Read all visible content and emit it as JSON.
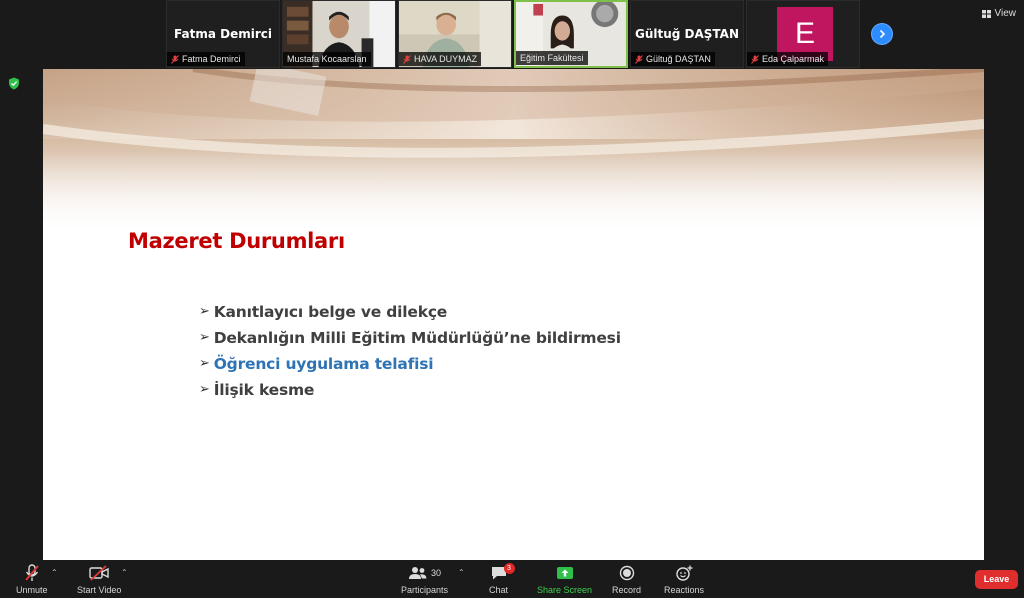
{
  "participants_strip": [
    {
      "name": "Fatma Demirci",
      "caption": "Fatma Demirci",
      "muted": true,
      "video": false
    },
    {
      "name": "Mustafa Kocaarslan",
      "caption": "Mustafa Kocaarslan",
      "muted": false,
      "video": true
    },
    {
      "name": "HAVA DUYMAZ",
      "caption": "HAVA DUYMAZ",
      "muted": true,
      "video": true
    },
    {
      "name": "Eğitim Fakültesi",
      "caption": "Eğitim Fakültesi",
      "muted": false,
      "video": true,
      "active": true
    },
    {
      "name": "Gültuğ DAŞTAN",
      "caption": "Gültuğ DAŞTAN",
      "muted": true,
      "video": false
    },
    {
      "name": "Eda Çalparmak",
      "caption": "Eda Çalparmak",
      "muted": true,
      "video": false,
      "avatar_letter": "E"
    }
  ],
  "view_label": "View",
  "slide": {
    "title": "Mazeret Durumları",
    "bullets": [
      "Kanıtlayıcı belge ve dilekçe",
      "Dekanlığın Milli Eğitim Müdürlüğü’ne bildirmesi",
      "Öğrenci uygulama telafisi",
      "İlişik kesme"
    ],
    "highlighted_bullet_index": 2,
    "title_color": "#c00000",
    "highlight_color": "#2e74b5"
  },
  "toolbar": {
    "unmute": "Unmute",
    "start_video": "Start Video",
    "participants": "Participants",
    "participants_count": "30",
    "chat": "Chat",
    "chat_badge": "3",
    "share_screen": "Share Screen",
    "record": "Record",
    "reactions": "Reactions",
    "leave": "Leave"
  },
  "colors": {
    "accent_blue": "#2d8cff",
    "share_green": "#3ecf52",
    "leave_red": "#e02d2d",
    "avatar_magenta": "#c0155f"
  }
}
